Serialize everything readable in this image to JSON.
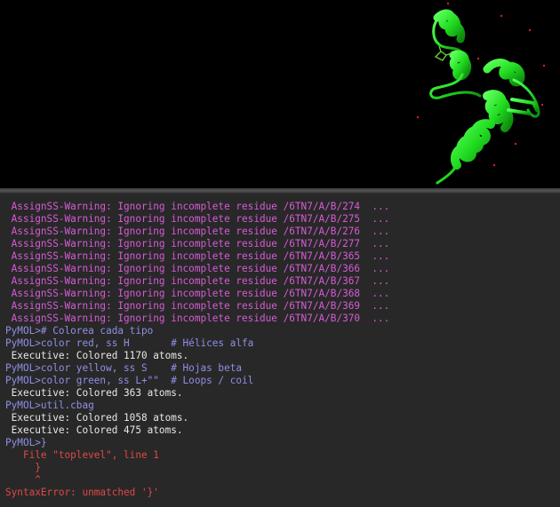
{
  "colors": {
    "viewport_bg": "#000000",
    "console_bg": "#282828",
    "warning": "#d65cd6",
    "command": "#8f8fe8",
    "output": "#e8e8e8",
    "error": "#e04848",
    "protein": "#22dd22"
  },
  "viewport": {
    "structure": "protein-cartoon-green"
  },
  "console": {
    "lines": [
      {
        "kind": "warn",
        "text": " AssignSS-Warning: Ignoring incomplete residue /6TN7/A/B/274  ..."
      },
      {
        "kind": "warn",
        "text": " AssignSS-Warning: Ignoring incomplete residue /6TN7/A/B/275  ..."
      },
      {
        "kind": "warn",
        "text": " AssignSS-Warning: Ignoring incomplete residue /6TN7/A/B/276  ..."
      },
      {
        "kind": "warn",
        "text": " AssignSS-Warning: Ignoring incomplete residue /6TN7/A/B/277  ..."
      },
      {
        "kind": "warn",
        "text": " AssignSS-Warning: Ignoring incomplete residue /6TN7/A/B/365  ..."
      },
      {
        "kind": "warn",
        "text": " AssignSS-Warning: Ignoring incomplete residue /6TN7/A/B/366  ..."
      },
      {
        "kind": "warn",
        "text": " AssignSS-Warning: Ignoring incomplete residue /6TN7/A/B/367  ..."
      },
      {
        "kind": "warn",
        "text": " AssignSS-Warning: Ignoring incomplete residue /6TN7/A/B/368  ..."
      },
      {
        "kind": "warn",
        "text": " AssignSS-Warning: Ignoring incomplete residue /6TN7/A/B/369  ..."
      },
      {
        "kind": "warn",
        "text": " AssignSS-Warning: Ignoring incomplete residue /6TN7/A/B/370  ..."
      },
      {
        "kind": "cmd",
        "text": "PyMOL># Colorea cada tipo"
      },
      {
        "kind": "cmd",
        "text": "PyMOL>color red, ss H       # Hélices alfa"
      },
      {
        "kind": "out",
        "text": " Executive: Colored 1170 atoms."
      },
      {
        "kind": "cmd",
        "text": "PyMOL>color yellow, ss S    # Hojas beta"
      },
      {
        "kind": "cmd",
        "text": "PyMOL>color green, ss L+\"\"  # Loops / coil"
      },
      {
        "kind": "out",
        "text": " Executive: Colored 363 atoms."
      },
      {
        "kind": "cmd",
        "text": "PyMOL>util.cbag"
      },
      {
        "kind": "out",
        "text": " Executive: Colored 1058 atoms."
      },
      {
        "kind": "out",
        "text": " Executive: Colored 475 atoms."
      },
      {
        "kind": "cmd",
        "text": "PyMOL>}"
      },
      {
        "kind": "err",
        "text": "   File \"toplevel\", line 1"
      },
      {
        "kind": "err",
        "text": "     }"
      },
      {
        "kind": "err",
        "text": "     ^"
      },
      {
        "kind": "err",
        "text": "SyntaxError: unmatched '}'"
      }
    ]
  }
}
